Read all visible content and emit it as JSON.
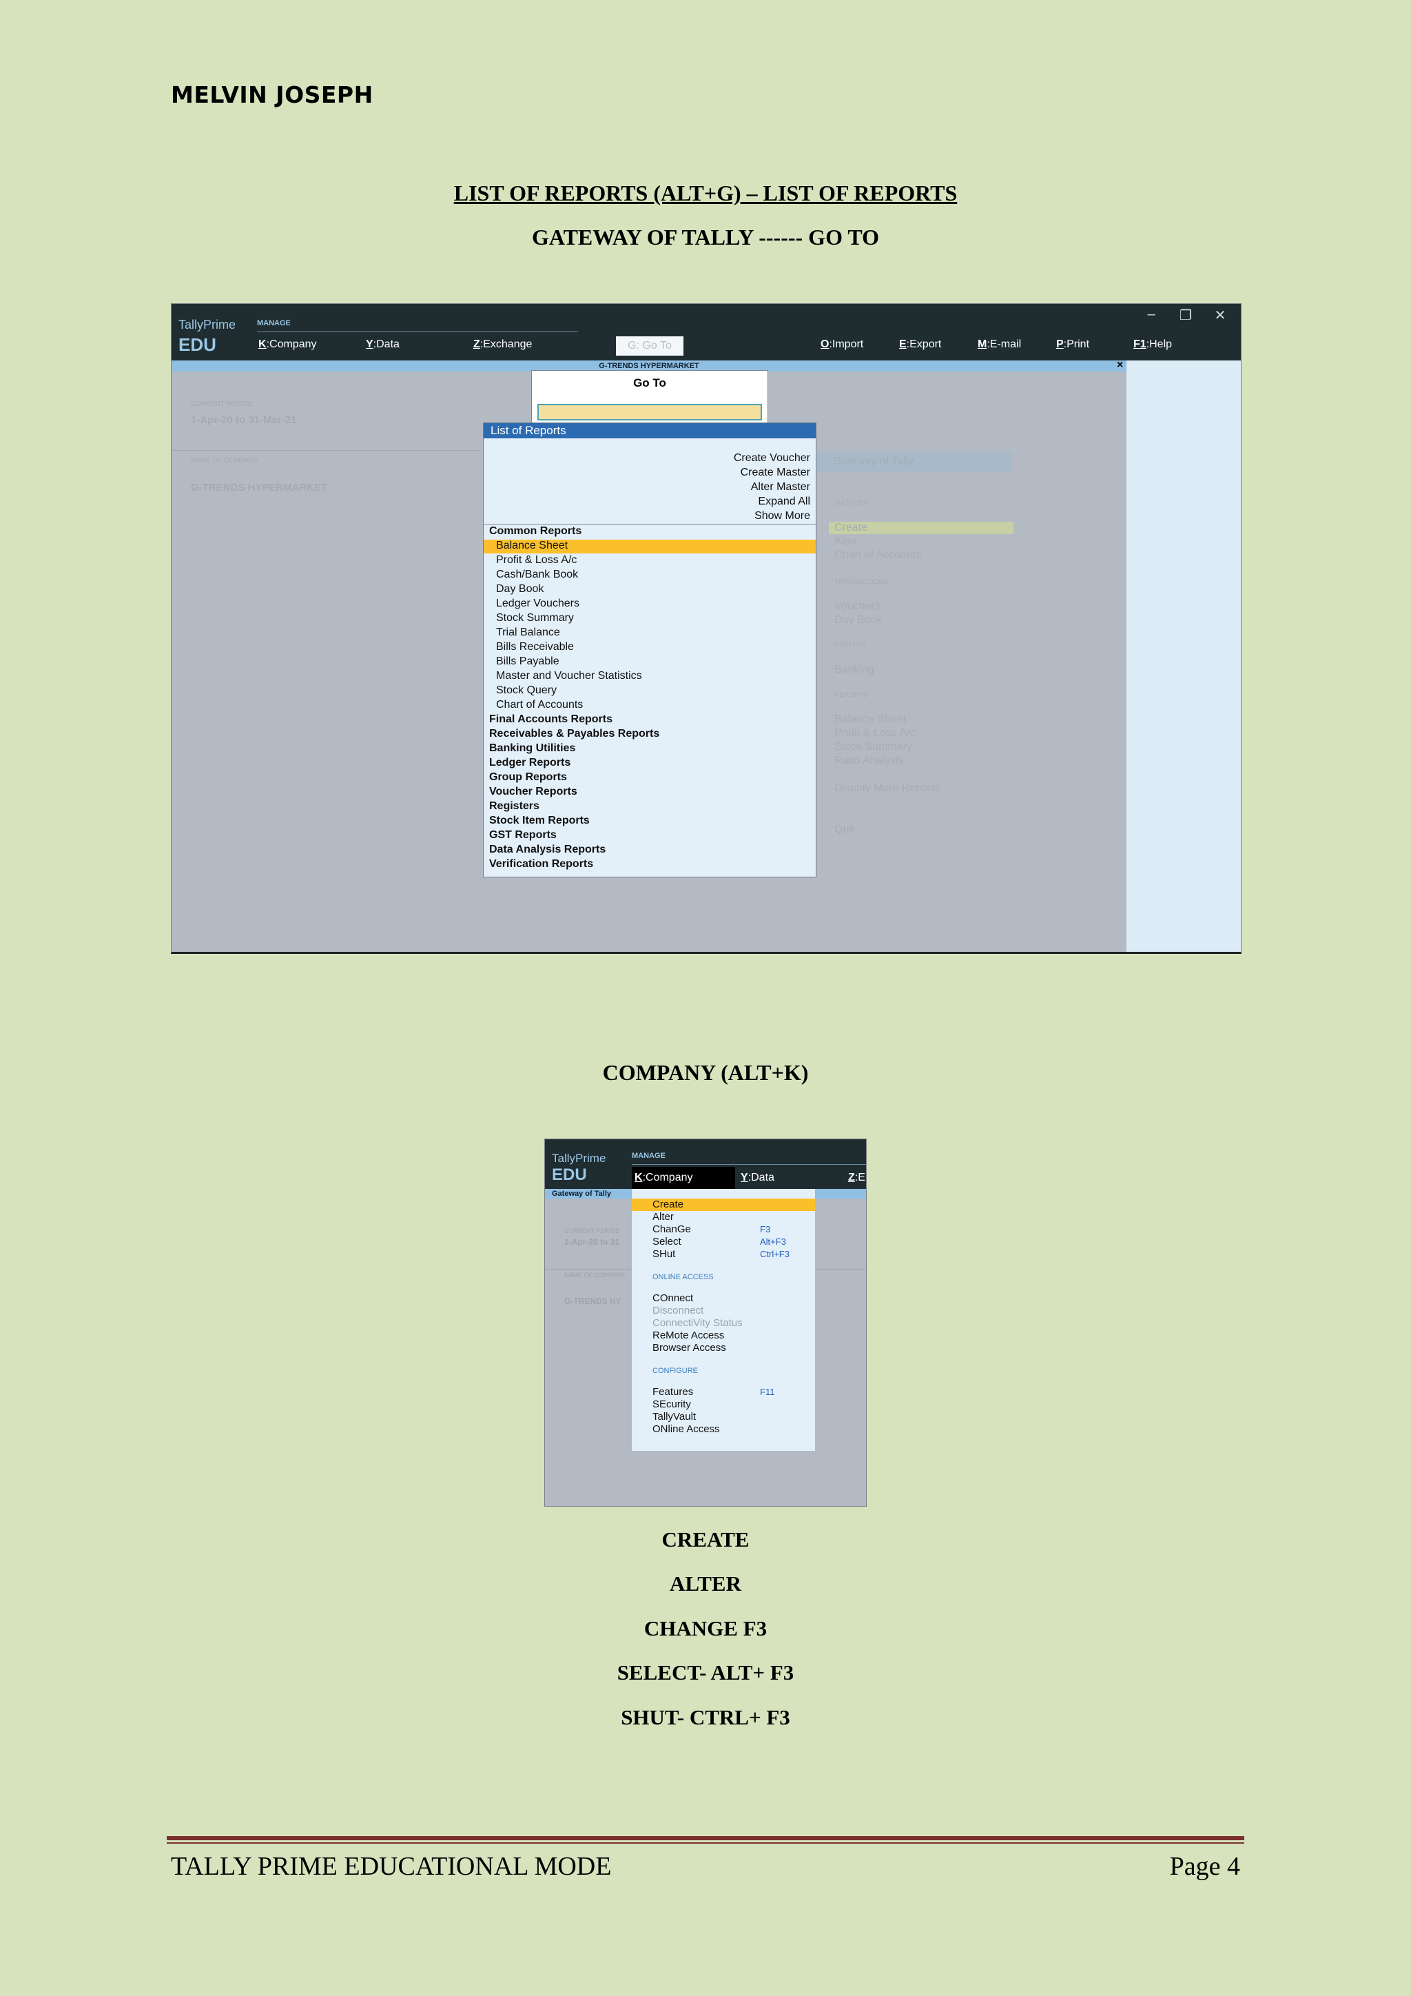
{
  "header": {
    "author": "MELVIN JOSEPH",
    "title": "LIST OF REPORTS (ALT+G) – LIST OF REPORTS",
    "subtitle": "GATEWAY OF TALLY ------ GO TO"
  },
  "shot1": {
    "brand": "TallyPrime",
    "edition": "EDU",
    "manage_label": "MANAGE",
    "menu": [
      {
        "key": "K",
        "label": "Company"
      },
      {
        "key": "Y",
        "label": "Data"
      },
      {
        "key": "Z",
        "label": "Exchange"
      },
      {
        "key": "O",
        "label": "Import"
      },
      {
        "key": "E",
        "label": "Export"
      },
      {
        "key": "M",
        "label": "E-mail"
      },
      {
        "key": "P",
        "label": "Print"
      },
      {
        "key": "F1",
        "label": "Help"
      }
    ],
    "goto_tab": "G: Go To",
    "company_strip": "G-TRENDS HYPERMARKET",
    "close": "×",
    "window_buttons": {
      "minimize": "–",
      "restore": "❐",
      "close": "✕"
    },
    "bg": {
      "period_label": "CURRENT PERIOD",
      "period": "1-Apr-20 to 31-Mar-21",
      "name_label": "NAME OF COMPANY",
      "company": "G-TRENDS HYPERMARKET",
      "gateway": "Gateway of Tally",
      "masters": "MASTERS",
      "create": "Create",
      "alter": "Alter",
      "chart": "Chart of Accounts",
      "transactions": "TRANSACTIONS",
      "vouchers": "Vouchers",
      "daybook": "Day Book",
      "utilities": "UTILITIES",
      "banking": "Banking",
      "reports": "REPORTS",
      "balance": "Balance Sheet",
      "pl": "Profit & Loss A/c",
      "stock": "Stock Summary",
      "ratio": "Ratio Analysis",
      "display": "Display More Reports",
      "quit": "Quit"
    },
    "goto_title": "Go To",
    "list_title": "List of Reports",
    "actions": [
      "Create Voucher",
      "Create Master",
      "Alter Master",
      "Expand All",
      "Show More"
    ],
    "common_header": "Common Reports",
    "common": [
      "Balance Sheet",
      "Profit & Loss A/c",
      "Cash/Bank Book",
      "Day Book",
      "Ledger Vouchers",
      "Stock Summary",
      "Trial Balance",
      "Bills Receivable",
      "Bills Payable",
      "Master and Voucher Statistics",
      "Stock Query",
      "Chart of Accounts"
    ],
    "groups": [
      "Final Accounts Reports",
      "Receivables & Payables Reports",
      "Banking Utilities",
      "Ledger Reports",
      "Group Reports",
      "Voucher Reports",
      "Registers",
      "Stock Item Reports",
      "GST Reports",
      "Data Analysis Reports",
      "Verification Reports"
    ]
  },
  "section2": {
    "title": "COMPANY (ALT+K)"
  },
  "shot2": {
    "brand": "TallyPrime",
    "edition": "EDU",
    "manage_label": "MANAGE",
    "company_tab": {
      "key": "K",
      "label": "Company"
    },
    "data_tab": {
      "key": "Y",
      "label": "Data"
    },
    "exchange_tab": {
      "key": "Z",
      "label": "E"
    },
    "gateway": "Gateway of Tally",
    "bg": {
      "period_label": "CURRENT PERIOD",
      "period": "1-Apr-20 to 31",
      "name_label": "NAME OF COMPANY",
      "company": "G-TRENDS HY"
    },
    "items": [
      {
        "label": "Create",
        "key": ""
      },
      {
        "label": "Alter",
        "key": ""
      },
      {
        "label": "ChanGe",
        "key": "F3"
      },
      {
        "label": "Select",
        "key": "Alt+F3"
      },
      {
        "label": "SHut",
        "key": "Ctrl+F3"
      }
    ],
    "online_header": "ONLINE ACCESS",
    "online": [
      "COnnect",
      "Disconnect",
      "ConnectiVity Status",
      "ReMote Access",
      "Browser Access"
    ],
    "configure_header": "CONFIGURE",
    "configure": [
      {
        "label": "Features",
        "key": "F11"
      },
      {
        "label": "SEcurity",
        "key": ""
      },
      {
        "label": "TallyVault",
        "key": ""
      },
      {
        "label": "ONline Access",
        "key": ""
      }
    ]
  },
  "commands": [
    "CREATE",
    "ALTER",
    "CHANGE F3",
    "SELECT- ALT+ F3",
    "SHUT- CTRL+ F3"
  ],
  "footer": {
    "left": "TALLY PRIME EDUCATIONAL MODE",
    "right": "Page 4"
  }
}
